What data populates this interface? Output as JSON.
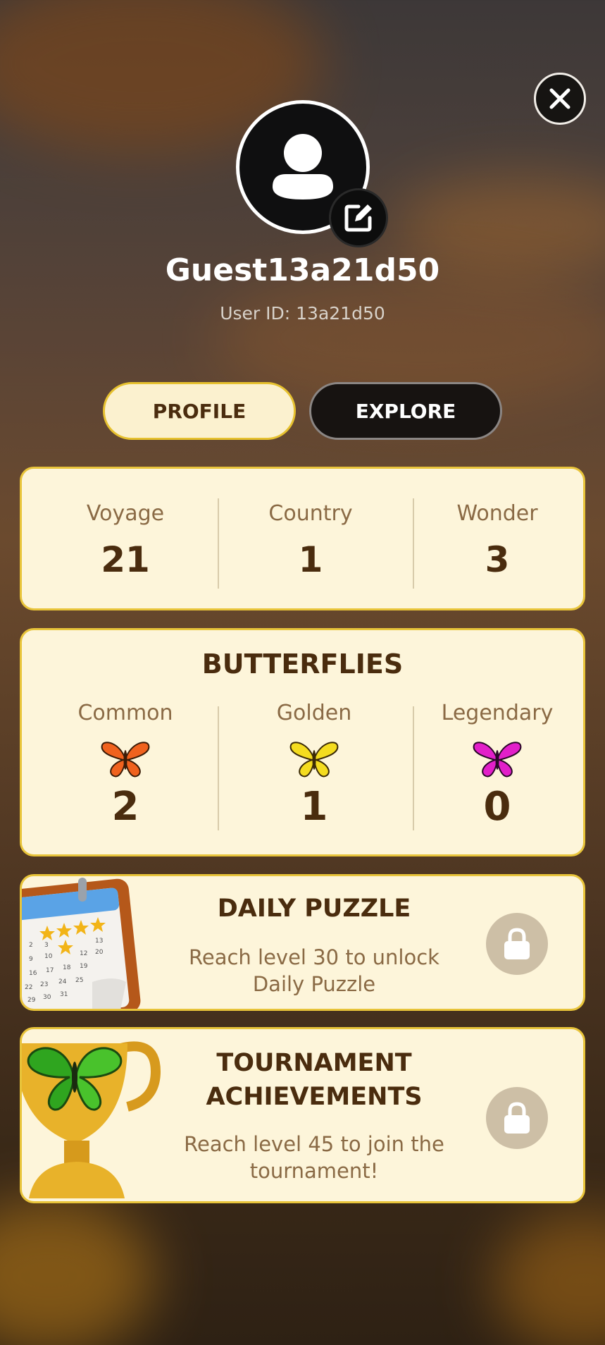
{
  "header": {
    "username": "Guest13a21d50",
    "user_id_text": "User ID: 13a21d50"
  },
  "tabs": [
    {
      "label": "PROFILE",
      "active": true
    },
    {
      "label": "EXPLORE",
      "active": false
    }
  ],
  "stats": [
    {
      "label": "Voyage",
      "value": "21"
    },
    {
      "label": "Country",
      "value": "1"
    },
    {
      "label": "Wonder",
      "value": "3"
    }
  ],
  "butterflies": {
    "title": "BUTTERFLIES",
    "items": [
      {
        "label": "Common",
        "value": "2",
        "icon": "orange-butterfly-icon",
        "color": "#f0621e"
      },
      {
        "label": "Golden",
        "value": "1",
        "icon": "yellow-butterfly-icon",
        "color": "#f4dc1f"
      },
      {
        "label": "Legendary",
        "value": "0",
        "icon": "magenta-butterfly-icon",
        "color": "#e21fc9"
      }
    ]
  },
  "daily_puzzle": {
    "title": "DAILY PUZZLE",
    "description_line1": "Reach level 30 to unlock",
    "description_line2": "Daily Puzzle"
  },
  "tournament": {
    "title_line1": "TOURNAMENT",
    "title_line2": "ACHIEVEMENTS",
    "description_line1": "Reach level 45 to join the",
    "description_line2": "tournament!"
  },
  "colors": {
    "card_bg": "#fdf5da",
    "card_border": "#e8c43a",
    "text_dark": "#4a2c0e",
    "text_muted": "#8a6a45"
  }
}
